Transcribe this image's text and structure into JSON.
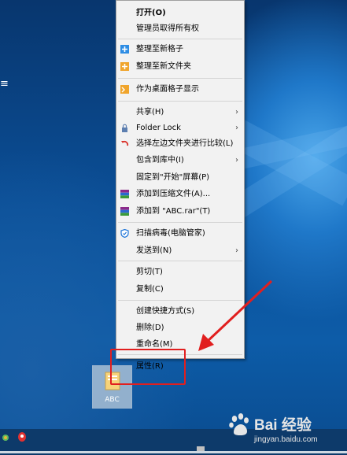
{
  "context_menu": {
    "items": [
      {
        "label": "打开(O)"
      },
      {
        "label": "管理员取得所有权"
      },
      {
        "label": "整理至新格子"
      },
      {
        "label": "整理至新文件夹"
      },
      {
        "label": "作为桌面格子显示"
      },
      {
        "label": "共享(H)"
      },
      {
        "label": "Folder Lock"
      },
      {
        "label": "选择左边文件夹进行比较(L)"
      },
      {
        "label": "包含到库中(I)"
      },
      {
        "label": "固定到\"开始\"屏幕(P)"
      },
      {
        "label": "添加到压缩文件(A)..."
      },
      {
        "label": "添加到 \"ABC.rar\"(T)"
      },
      {
        "label": "扫描病毒(电脑管家)"
      },
      {
        "label": "发送到(N)"
      },
      {
        "label": "剪切(T)"
      },
      {
        "label": "复制(C)"
      },
      {
        "label": "创建快捷方式(S)"
      },
      {
        "label": "删除(D)"
      },
      {
        "label": "重命名(M)"
      },
      {
        "label": "属性(R)"
      }
    ],
    "arrow_glyph": "›"
  },
  "desktop": {
    "file_label": "ABC",
    "left_glyph": "≡"
  },
  "annotation": {
    "color": "#e11f1f"
  },
  "watermark": {
    "main": "Bai 经验",
    "sub": "jingyan.baidu.com"
  }
}
